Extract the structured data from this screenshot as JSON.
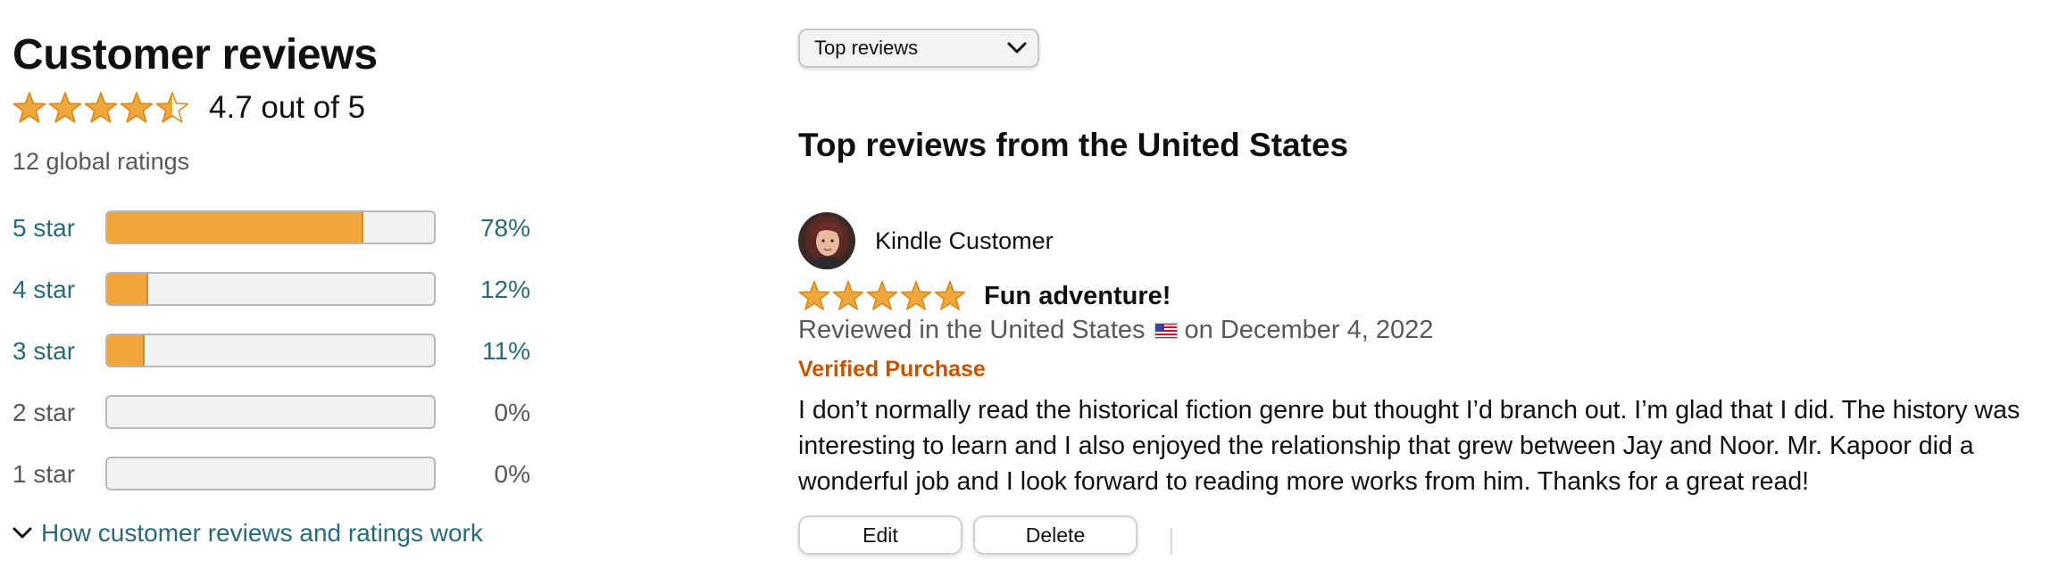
{
  "reviews_summary": {
    "title": "Customer reviews",
    "average_rating": 4.7,
    "rating_text": "4.7 out of 5",
    "global_ratings": "12 global ratings",
    "histogram": [
      {
        "label": "5 star",
        "percent_text": "78%",
        "percent": 78,
        "linked": true
      },
      {
        "label": "4 star",
        "percent_text": "12%",
        "percent": 12,
        "linked": true
      },
      {
        "label": "3 star",
        "percent_text": "11%",
        "percent": 11,
        "linked": true
      },
      {
        "label": "2 star",
        "percent_text": "0%",
        "percent": 0,
        "linked": false
      },
      {
        "label": "1 star",
        "percent_text": "0%",
        "percent": 0,
        "linked": false
      }
    ],
    "how_link": "How customer reviews and ratings work"
  },
  "sort": {
    "selected": "Top reviews"
  },
  "top_reviews": {
    "heading": "Top reviews from the United States",
    "review": {
      "reviewer": "Kindle Customer",
      "rating": 5,
      "title": "Fun adventure!",
      "reviewed_prefix": "Reviewed in the United States",
      "reviewed_date": "on December 4, 2022",
      "verified": "Verified Purchase",
      "body": "I don’t normally read the historical fiction genre but thought I’d branch out. I’m glad that I did. The history was interesting to learn and I also enjoyed the relationship that grew between Jay and Noor. Mr. Kapoor did a wonderful job and I look forward to reading more works from him. Thanks for a great read!",
      "edit_label": "Edit",
      "delete_label": "Delete"
    }
  },
  "colors": {
    "star": "#f0a63a",
    "link": "#2a6a78",
    "verified": "#c45500",
    "bar_fill": "#f0a63a"
  }
}
